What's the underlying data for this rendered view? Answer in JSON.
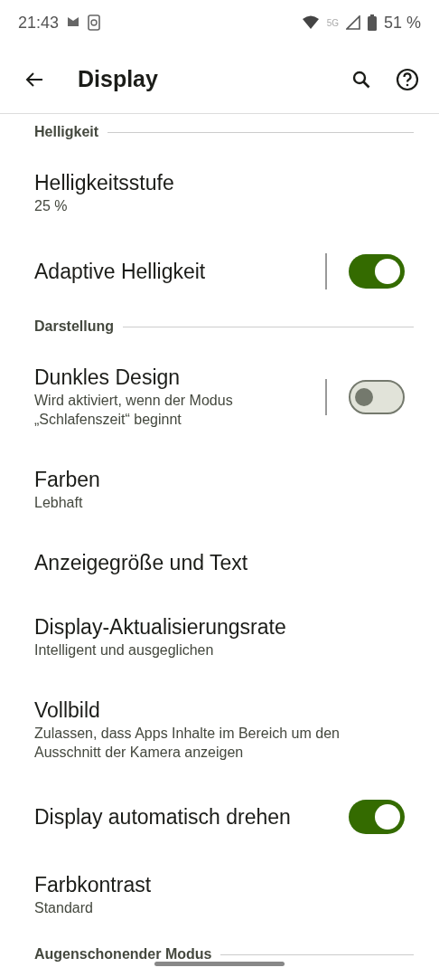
{
  "status_bar": {
    "time": "21:43",
    "network": "5G",
    "battery": "51 %"
  },
  "app_bar": {
    "title": "Display"
  },
  "items": [
    {
      "kind": "header",
      "title": "Helligkeit"
    },
    {
      "kind": "item",
      "title": "Helligkeitsstufe",
      "summary": "25 %"
    },
    {
      "kind": "switch",
      "title": "Adaptive Helligkeit",
      "on": true,
      "divider": true
    },
    {
      "kind": "header",
      "title": "Darstellung"
    },
    {
      "kind": "switch",
      "title": "Dunkles Design",
      "summary": "Wird aktiviert, wenn der Modus „Schlafenszeit“ beginnt",
      "on": false,
      "divider": true
    },
    {
      "kind": "item",
      "title": "Farben",
      "summary": "Lebhaft"
    },
    {
      "kind": "item",
      "title": "Anzeigegröße und Text"
    },
    {
      "kind": "item",
      "title": "Display-Aktualisierungsrate",
      "summary": "Intelligent und ausgeglichen"
    },
    {
      "kind": "item",
      "title": "Vollbild",
      "summary": "Zulassen, dass Apps Inhalte im Bereich um den Ausschnitt der Kamera anzeigen"
    },
    {
      "kind": "switch",
      "title": "Display automatisch drehen",
      "on": true,
      "divider": false
    },
    {
      "kind": "item",
      "title": "Farbkontrast",
      "summary": "Standard"
    },
    {
      "kind": "header",
      "title": "Augenschonender Modus"
    }
  ]
}
